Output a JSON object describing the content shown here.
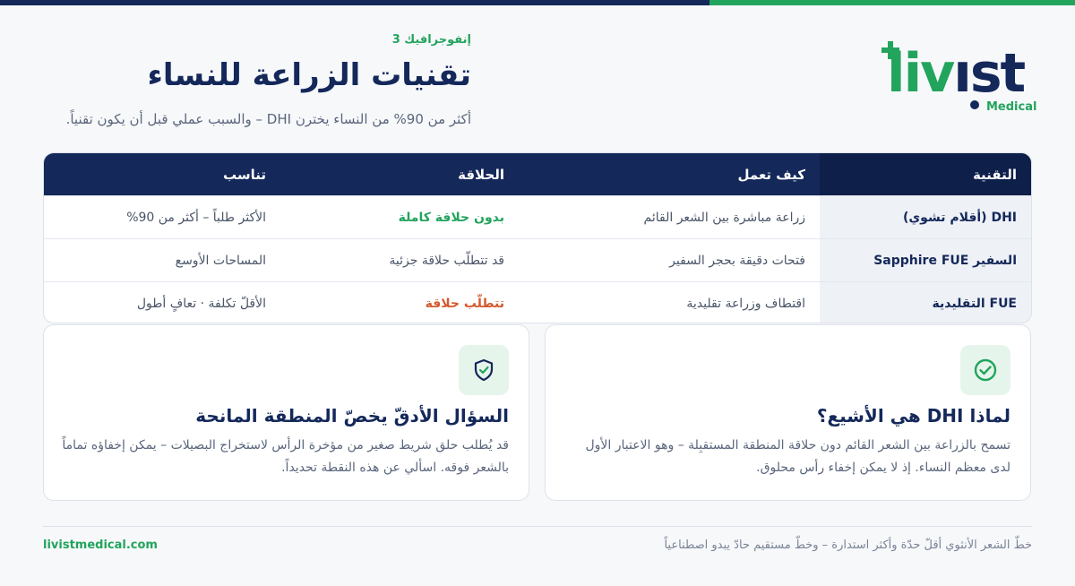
{
  "brand": {
    "logo_text": "livist",
    "logo_sub": "Medical",
    "color_green": "#22a45d",
    "color_navy": "#14285a"
  },
  "header": {
    "eyebrow": "إنفوجرافيك 3",
    "title": "تقنيات الزراعة للنساء",
    "subtitle": "أكثر من 90% من النساء يخترن DHI – والسبب عملي قبل أن يكون تقنياً."
  },
  "table": {
    "columns": [
      "التقنية",
      "كيف تعمل",
      "الحلاقة",
      "تناسب"
    ],
    "rows": [
      {
        "technique": "DHI (أقلام تشوي)",
        "how": "زراعة مباشرة بين الشعر القائم",
        "shaving": "بدون حلاقة كاملة",
        "shaving_status": "good",
        "fit": "الأكثر طلباً – أكثر من 90%"
      },
      {
        "technique": "السفير Sapphire FUE",
        "how": "فتحات دقيقة بحجر السفير",
        "shaving": "قد تتطلّب حلاقة جزئية",
        "shaving_status": "neutral",
        "fit": "المساحات الأوسع"
      },
      {
        "technique": "FUE التقليدية",
        "how": "اقتطاف وزراعة تقليدية",
        "shaving": "تتطلّب حلاقة",
        "shaving_status": "bad",
        "fit": "الأقلّ تكلفة · تعافٍ أطول"
      }
    ]
  },
  "cards": {
    "why": {
      "icon": "check-circle-icon",
      "title": "لماذا DHI هي الأشيع؟",
      "body": "تسمح بالزراعة بين الشعر القائم دون حلاقة المنطقة المستقبِلة – وهو الاعتبار الأول لدى معظم النساء. إذ لا يمكن إخفاء رأس محلوق."
    },
    "question": {
      "icon": "shield-check-icon",
      "title": "السؤال الأدقّ يخصّ المنطقة المانحة",
      "body": "قد يُطلب حلق شريط صغير من مؤخرة الرأس لاستخراج البصيلات – يمكن إخفاؤه تماماً بالشعر فوقه. اسألي عن هذه النقطة تحديداً."
    }
  },
  "footer": {
    "site": "livistmedical.com",
    "note": "خطّ الشعر الأنثوي أقلّ حدّة وأكثر استدارة – وخطّ مستقيم حادّ يبدو اصطناعياً"
  }
}
